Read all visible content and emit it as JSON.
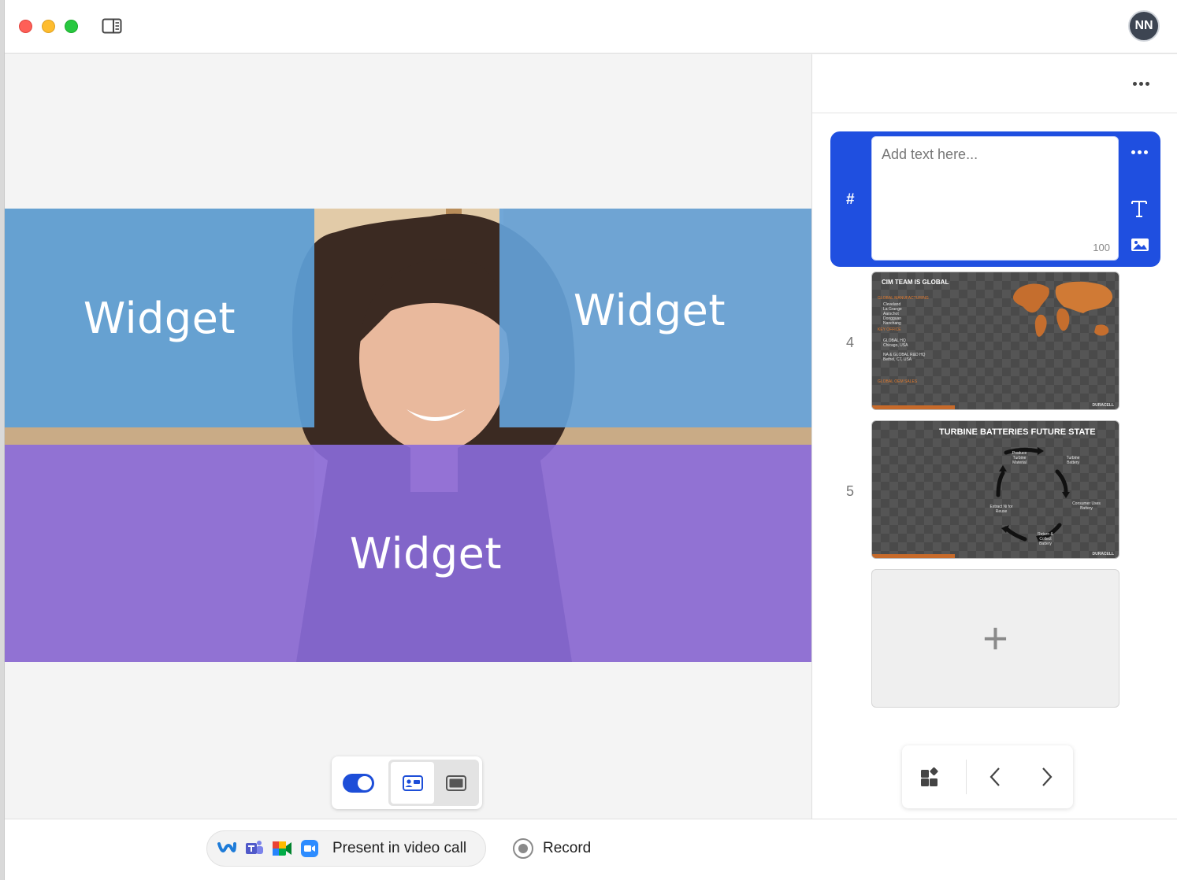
{
  "titlebar": {
    "avatar_initials": "NN"
  },
  "stage": {
    "widgets": [
      {
        "label": "Widget"
      },
      {
        "label": "Widget"
      },
      {
        "label": "Widget"
      }
    ]
  },
  "bottombar": {
    "present_label": "Present in video call",
    "record_label": "Record"
  },
  "right_panel": {
    "active_slide": {
      "number": "#",
      "placeholder": "Add text here...",
      "char_limit": "100"
    },
    "slides": [
      {
        "number": "4",
        "title": "CIM TEAM IS GLOBAL",
        "brand": "DURACELL"
      },
      {
        "number": "5",
        "title": "TURBINE BATTERIES  FUTURE STATE",
        "cycle": [
          "Produce Turbine Material",
          "Turbine Battery",
          "Consumer Uses Battery",
          "Return & Collect Battery",
          "Extract Ni for Reuse"
        ],
        "brand": "DURACELL"
      }
    ],
    "add_symbol": "+"
  },
  "colors": {
    "accent": "#1f4fe0",
    "widget_blue": "#5da0d8",
    "widget_purple": "#8b6cdc"
  }
}
